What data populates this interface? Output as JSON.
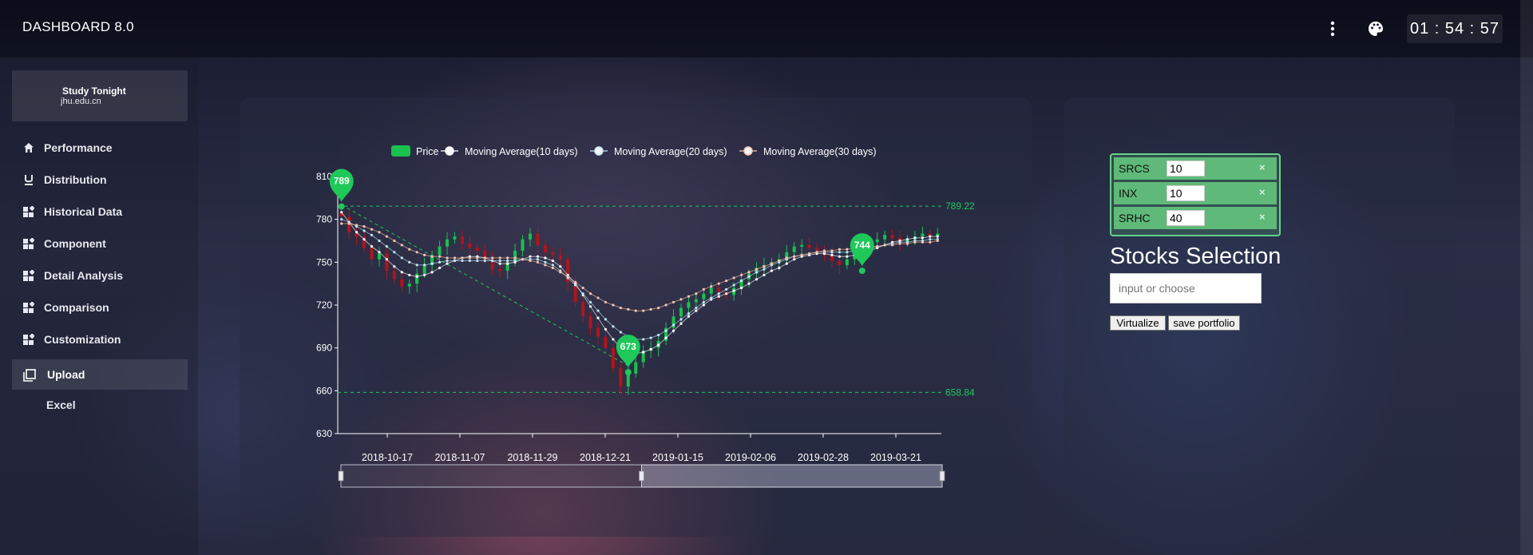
{
  "app": {
    "title": "DASHBOARD 8.0",
    "clock": "01 : 54 : 57",
    "more_icon": "vertical-dots-icon",
    "palette_icon": "palette-icon"
  },
  "profile": {
    "name": "Study Tonight",
    "domain": "jhu.edu.cn"
  },
  "sidebar": {
    "items": [
      {
        "label": "Performance",
        "icon": "home-icon"
      },
      {
        "label": "Distribution",
        "icon": "underline-icon"
      },
      {
        "label": "Historical Data",
        "icon": "widgets-icon"
      },
      {
        "label": "Component",
        "icon": "widgets-icon"
      },
      {
        "label": "Detail Analysis",
        "icon": "widgets-icon"
      },
      {
        "label": "Comparison",
        "icon": "widgets-icon"
      },
      {
        "label": "Customization",
        "icon": "widgets-icon"
      },
      {
        "label": "Upload",
        "icon": "library-icon"
      }
    ],
    "active": "Upload",
    "sub_item": "Excel"
  },
  "stocks": {
    "rows": [
      {
        "symbol": "SRCS",
        "value": "10",
        "remove": "×"
      },
      {
        "symbol": "INX",
        "value": "10",
        "remove": "×"
      },
      {
        "symbol": "SRHC",
        "value": "40",
        "remove": "×"
      }
    ],
    "title": "Stocks Selection",
    "placeholder": "input or choose",
    "virtualize_label": "Virtualize",
    "save_label": "save portfolio"
  },
  "colors": {
    "accent": "#1ec95a",
    "up": "#19c24e",
    "down": "#b3131b",
    "ma10": "#ffffff",
    "ma20": "#bde9f2",
    "ma30": "#f7c3ad"
  },
  "chart_data": {
    "type": "candlestick",
    "legend": [
      "Price",
      "Moving Average(10 days)",
      "Moving Average(20 days)",
      "Moving Average(30 days)"
    ],
    "legend_position": "top-center",
    "x_labels": [
      "2018-10-17",
      "2018-11-07",
      "2018-11-29",
      "2018-12-21",
      "2019-01-15",
      "2019-02-06",
      "2019-02-28",
      "2019-03-21"
    ],
    "y_ticks": [
      630,
      660,
      690,
      720,
      750,
      780,
      810
    ],
    "ylim": [
      630,
      810
    ],
    "grid": false,
    "close": [
      782,
      771,
      768,
      760,
      752,
      756,
      744,
      738,
      733,
      735,
      742,
      748,
      755,
      761,
      766,
      768,
      763,
      760,
      758,
      752,
      745,
      744,
      750,
      758,
      766,
      770,
      762,
      757,
      755,
      752,
      736,
      722,
      712,
      704,
      698,
      690,
      676,
      663,
      672,
      680,
      688,
      690,
      695,
      704,
      712,
      718,
      722,
      724,
      728,
      732,
      729,
      727,
      732,
      738,
      742,
      746,
      748,
      750,
      752,
      757,
      761,
      762,
      760,
      758,
      755,
      751,
      748,
      752,
      756,
      760,
      764,
      766,
      769,
      767,
      764,
      766,
      768,
      770,
      768,
      770
    ],
    "ma10": [
      785,
      778,
      771,
      766,
      761,
      757,
      752,
      747,
      743,
      741,
      740,
      741,
      743,
      746,
      749,
      751,
      753,
      754,
      754,
      753,
      751,
      749,
      749,
      750,
      752,
      754,
      754,
      753,
      751,
      747,
      741,
      735,
      727,
      719,
      711,
      703,
      696,
      690,
      687,
      686,
      687,
      689,
      692,
      697,
      702,
      707,
      712,
      716,
      720,
      724,
      726,
      728,
      730,
      732,
      735,
      738,
      741,
      744,
      746,
      749,
      752,
      754,
      755,
      756,
      756,
      755,
      754,
      754,
      755,
      757,
      758,
      760,
      762,
      764,
      765,
      766,
      767,
      767,
      768,
      768
    ],
    "ma20": [
      780,
      778,
      775,
      772,
      769,
      765,
      761,
      757,
      753,
      750,
      748,
      748,
      749,
      750,
      751,
      751,
      751,
      751,
      751,
      751,
      751,
      751,
      751,
      751,
      752,
      752,
      752,
      750,
      748,
      744,
      739,
      734,
      728,
      722,
      716,
      710,
      705,
      701,
      698,
      696,
      696,
      697,
      699,
      702,
      706,
      710,
      714,
      718,
      722,
      725,
      728,
      731,
      734,
      737,
      740,
      743,
      745,
      748,
      750,
      752,
      754,
      755,
      756,
      757,
      757,
      757,
      757,
      757,
      758,
      759,
      760,
      761,
      762,
      763,
      764,
      764,
      765,
      765,
      766,
      766
    ],
    "ma30": [
      777,
      777,
      776,
      775,
      773,
      771,
      768,
      765,
      762,
      759,
      757,
      755,
      754,
      754,
      753,
      753,
      753,
      753,
      753,
      753,
      753,
      753,
      753,
      753,
      752,
      751,
      750,
      748,
      746,
      743,
      740,
      736,
      732,
      728,
      725,
      722,
      720,
      718,
      717,
      716,
      716,
      717,
      718,
      720,
      722,
      724,
      726,
      728,
      731,
      733,
      735,
      737,
      739,
      741,
      743,
      745,
      747,
      749,
      751,
      753,
      754,
      755,
      756,
      757,
      758,
      758,
      759,
      759,
      760,
      760,
      761,
      761,
      762,
      762,
      763,
      763,
      764,
      764,
      764,
      765
    ],
    "mark_points": [
      {
        "label": "789",
        "index": 0,
        "value": 789
      },
      {
        "label": "673",
        "index": 38,
        "value": 673
      },
      {
        "label": "744",
        "index": 69,
        "value": 744
      }
    ],
    "mark_lines": [
      {
        "label": "789.22",
        "value": 789.22
      },
      {
        "label": "658.84",
        "value": 658.84
      }
    ],
    "data_zoom": {
      "start": 0,
      "split": 0.5,
      "end": 1
    }
  }
}
